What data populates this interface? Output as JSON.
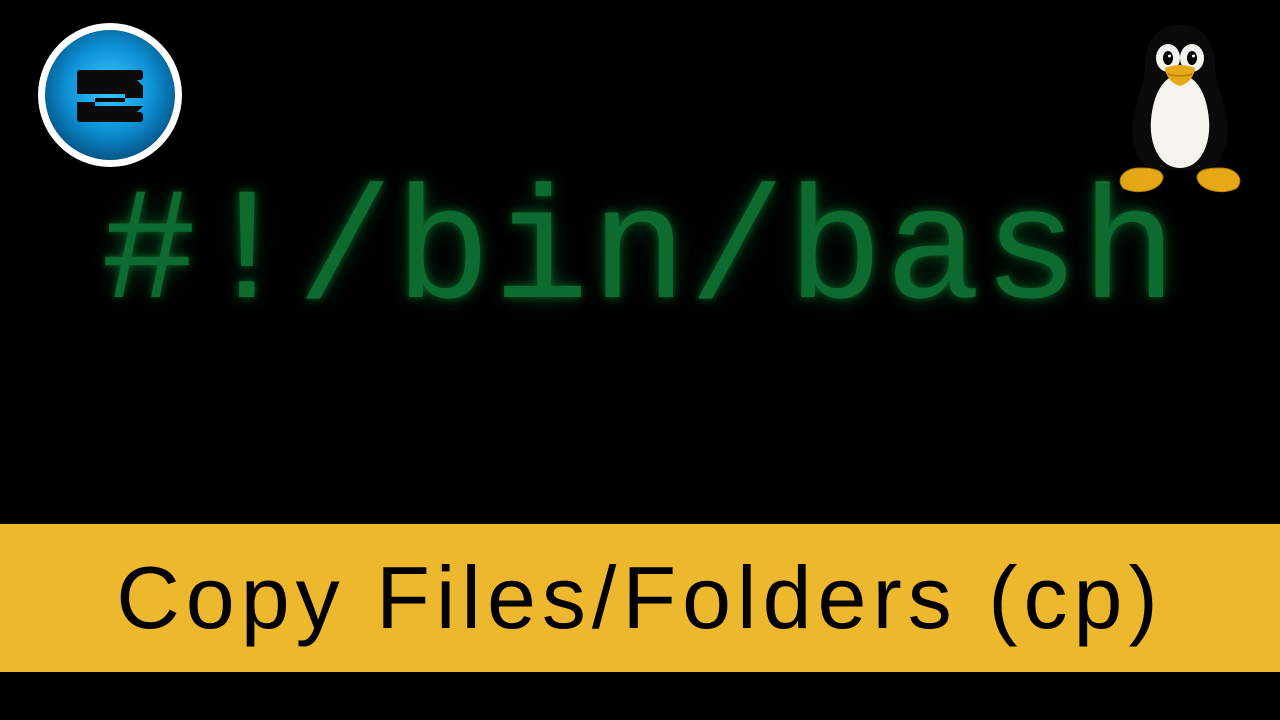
{
  "shebang_text": "#!/bin/bash",
  "title_text": "Copy Files/Folders (cp)",
  "colors": {
    "background": "#000000",
    "shebang_green": "#0d6b2f",
    "title_bar": "#eeb82e",
    "title_text": "#000000"
  },
  "icons": {
    "top_left": "sonar-logo-icon",
    "top_right": "tux-penguin-icon"
  }
}
